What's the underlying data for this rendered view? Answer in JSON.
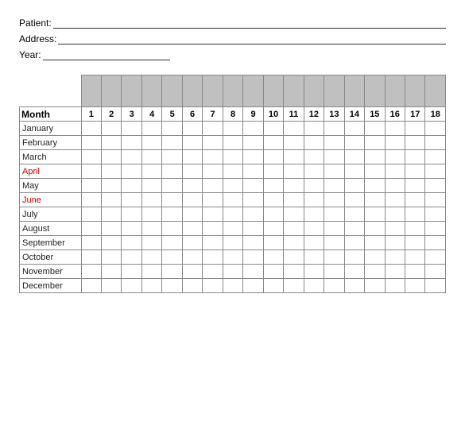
{
  "form": {
    "patient_label": "Patient:",
    "address_label": "Address:",
    "year_label": "Year:"
  },
  "table": {
    "month_header": "Month",
    "day_numbers": [
      1,
      2,
      3,
      4,
      5,
      6,
      7,
      8,
      9,
      10,
      11,
      12,
      13,
      14,
      15,
      16,
      17,
      18
    ],
    "months": [
      {
        "name": "January",
        "class": "row-jan"
      },
      {
        "name": "February",
        "class": "row-feb"
      },
      {
        "name": "March",
        "class": "row-mar"
      },
      {
        "name": "April",
        "class": "row-apr"
      },
      {
        "name": "May",
        "class": "row-may"
      },
      {
        "name": "June",
        "class": "row-jun"
      },
      {
        "name": "July",
        "class": "row-jul"
      },
      {
        "name": "August",
        "class": "row-aug"
      },
      {
        "name": "September",
        "class": "row-sep"
      },
      {
        "name": "October",
        "class": "row-oct"
      },
      {
        "name": "November",
        "class": "row-nov"
      },
      {
        "name": "December",
        "class": "row-dec"
      }
    ]
  }
}
